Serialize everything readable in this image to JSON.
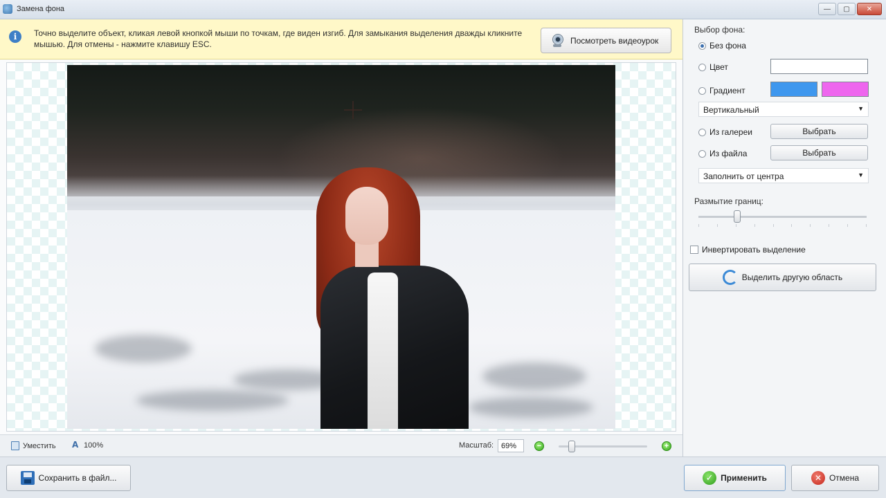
{
  "window": {
    "title": "Замена фона",
    "minimize_glyph": "—",
    "maximize_glyph": "▢",
    "close_glyph": "✕"
  },
  "hint": {
    "icon_glyph": "i",
    "text": "Точно выделите объект, кликая левой кнопкой мыши по точкам, где виден изгиб. Для замыкания выделения дважды кликните мышью. Для отмены - нажмите клавишу ESC.",
    "video_button_label": "Посмотреть видеоурок"
  },
  "status": {
    "fit_label": "Уместить",
    "actual_size_label": "100%",
    "scale_label": "Масштаб:",
    "scale_value": "69%",
    "zoom_out_glyph": "−",
    "zoom_in_glyph": "+",
    "zoom_level_fraction": 0.12
  },
  "background_panel": {
    "group_label": "Выбор фона:",
    "options": {
      "none": "Без фона",
      "color": "Цвет",
      "gradient": "Градиент",
      "gallery": "Из галереи",
      "file": "Из файла"
    },
    "selected_option": "none",
    "color_value": "#ffffff",
    "gradient_colors": [
      "#3e97ee",
      "#ee66ee"
    ],
    "gradient_direction": "Вертикальный",
    "gallery_button": "Выбрать",
    "file_button": "Выбрать",
    "fill_mode": "Заполнить от центра",
    "dropdown_glyph": "▼",
    "blur_label": "Размытие границ:",
    "blur_level_fraction": 0.22,
    "invert_label": "Инвертировать выделение",
    "invert_checked": false,
    "select_other_button": "Выделить другую область"
  },
  "footer": {
    "save_button": "Сохранить в файл...",
    "apply_button": "Применить",
    "apply_glyph": "✓",
    "cancel_button": "Отмена",
    "cancel_glyph": "✕"
  }
}
